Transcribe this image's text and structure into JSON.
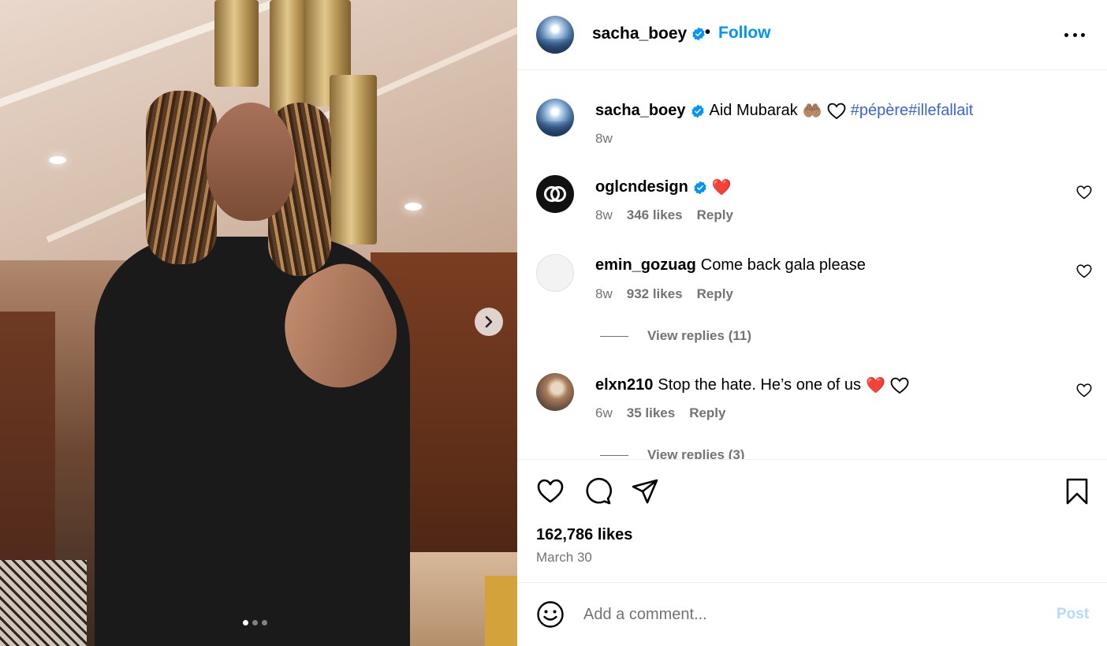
{
  "post": {
    "author": "sacha_boey",
    "separator": "•",
    "follow_label": "Follow",
    "caption_text": "Aid Mubarak",
    "caption_emoji": "🤲🏽",
    "caption_hashtags": "#pépère#illefallait",
    "caption_age": "8w",
    "likes": "162,786 likes",
    "date": "March 30",
    "carousel": {
      "total": 3,
      "current": 1
    }
  },
  "comments": [
    {
      "username": "oglcndesign",
      "verified": true,
      "text": "",
      "emoji": "❤️",
      "age": "8w",
      "likes": "346 likes",
      "reply_label": "Reply"
    },
    {
      "username": "emin_gozuag",
      "verified": false,
      "text": "Come back gala please",
      "age": "8w",
      "likes": "932 likes",
      "reply_label": "Reply",
      "view_replies": "View replies (11)"
    },
    {
      "username": "elxn210",
      "verified": false,
      "text": "Stop the hate. He’s one of us",
      "emoji": "❤️",
      "age": "6w",
      "likes": "35 likes",
      "reply_label": "Reply",
      "view_replies": "View replies (3)"
    }
  ],
  "composer": {
    "placeholder": "Add a comment...",
    "post_label": "Post"
  },
  "colors": {
    "accent": "#0095f6",
    "hashtag": "#3d63d6",
    "muted": "#737373",
    "post_disabled": "#b3dbff"
  }
}
